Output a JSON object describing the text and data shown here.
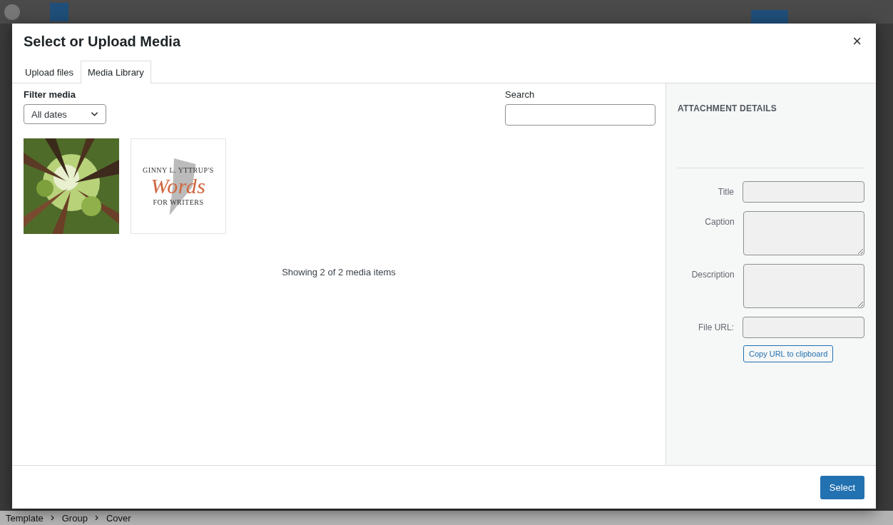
{
  "modal": {
    "title": "Select or Upload Media",
    "close": "×"
  },
  "tabs": [
    {
      "label": "Upload files",
      "selected": false
    },
    {
      "label": "Media Library",
      "selected": true
    }
  ],
  "filter": {
    "label": "Filter media",
    "value": "All dates"
  },
  "search": {
    "label": "Search"
  },
  "media_items": [
    {
      "kind": "picture",
      "selected": false
    },
    {
      "kind": "logo",
      "selected": false,
      "lines": [
        "GINNY L. YTTRUP'S",
        "Words",
        "FOR WRITERS"
      ]
    }
  ],
  "count": "Showing 2 of 2 media items",
  "details": {
    "heading": "ATTACHMENT DETAILS",
    "fields": [
      {
        "label": "Title",
        "kind": "input"
      },
      {
        "label": "Caption",
        "kind": "textarea"
      },
      {
        "label": "Description",
        "kind": "textarea"
      },
      {
        "label": "File URL:",
        "kind": "input"
      }
    ],
    "copy_button": "Copy URL to clipboard"
  },
  "select_button": "Select",
  "breadcrumb": [
    "Template",
    "Group",
    "Cover"
  ]
}
